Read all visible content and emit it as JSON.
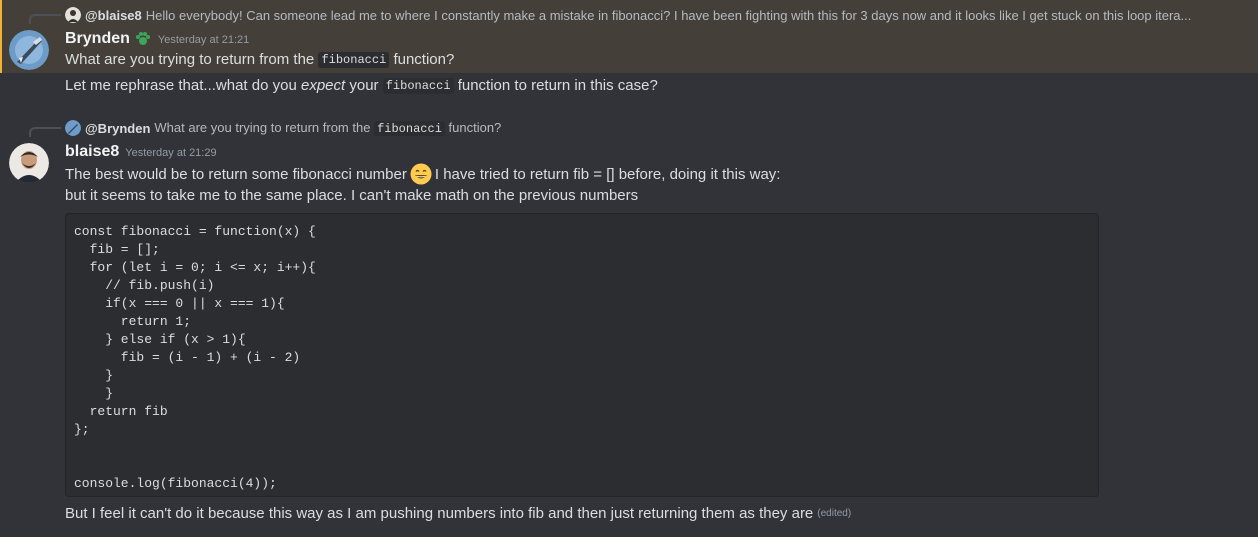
{
  "reply_top": {
    "username": "@blaise8",
    "text": "Hello everybody! Can someone lead me to where I constantly make a mistake in fibonacci? I have been fighting with this for 3 days now and it looks like I get stuck on this loop itera..."
  },
  "message1": {
    "username": "Brynden",
    "timestamp": "Yesterday at 21:21",
    "badge_icon": "paw-badge-icon",
    "badge_color": "#3ba55c",
    "line1_before": "What are you trying to return from the",
    "line1_code": "fibonacci",
    "line1_after": "function?",
    "line2_before": "Let me rephrase that...what do you",
    "line2_em": "expect",
    "line2_mid": "your",
    "line2_code": "fibonacci",
    "line2_after": "function to return in this case?"
  },
  "reply_second": {
    "username": "@Brynden",
    "text_before": "What are you trying to return from the",
    "text_code": "fibonacci",
    "text_after": "function?"
  },
  "message2": {
    "username": "blaise8",
    "timestamp": "Yesterday at 21:29",
    "line1_before": "The best would be to return some fibonacci number",
    "line1_emoji": "grinning-emoji",
    "line1_after": "I have tried to return fib = [] before, doing it this way:",
    "line2": "but it seems to take me to the same place. I can't make math on the previous numbers",
    "code": "const fibonacci = function(x) {\n  fib = [];\n  for (let i = 0; i <= x; i++){\n    // fib.push(i)\n    if(x === 0 || x === 1){\n      return 1;\n    } else if (x > 1){\n      fib = (i - 1) + (i - 2)\n    }\n    }\n  return fib\n};\n\n\nconsole.log(fibonacci(4));",
    "line3": "But I feel it can't do it because this way as I am pushing numbers into fib and then just returning them as they are",
    "edited": "(edited)"
  }
}
